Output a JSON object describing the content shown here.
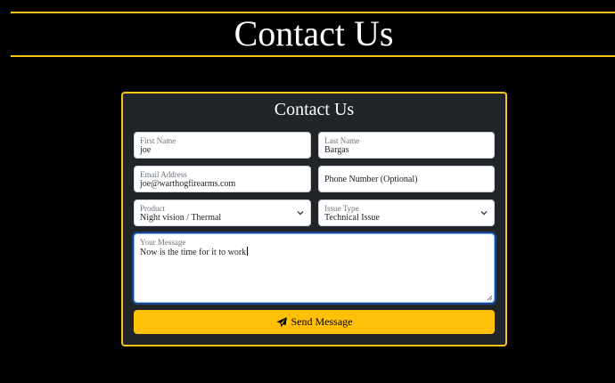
{
  "page": {
    "title": "Contact Us"
  },
  "card": {
    "title": "Contact Us"
  },
  "form": {
    "first_name": {
      "label": "First Name",
      "value": "joe"
    },
    "last_name": {
      "label": "Last Name",
      "value": "Bargas"
    },
    "email": {
      "label": "Email Address",
      "value": "joe@warthogfirearms.com"
    },
    "phone": {
      "placeholder": "Phone Number (Optional)"
    },
    "product": {
      "label": "Product",
      "value": "Night vision / Thermal"
    },
    "issue_type": {
      "label": "Issue Type",
      "value": "Technical Issue"
    },
    "message": {
      "label": "Your Message",
      "value": "Now is the time for it to work"
    },
    "send_label": "Send Message"
  },
  "colors": {
    "accent": "#f5c518",
    "button": "#ffc107",
    "card_bg": "#212529",
    "page_bg": "#000000"
  },
  "icons": {
    "send": "paper-plane-icon",
    "select": "chevron-down-icon"
  }
}
